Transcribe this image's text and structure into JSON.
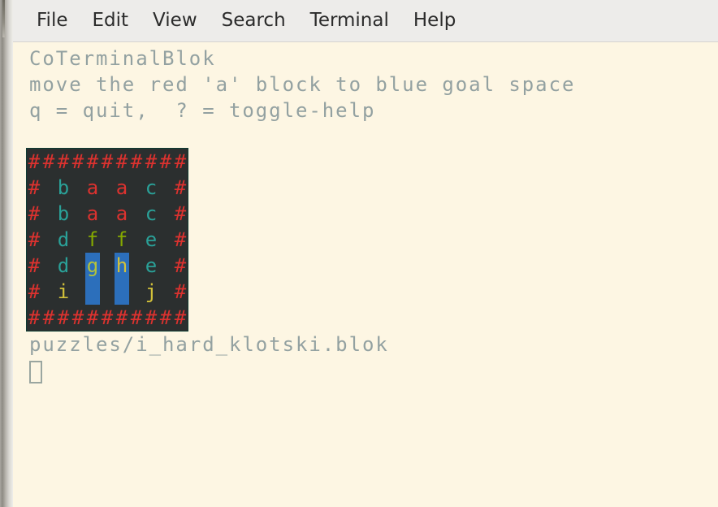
{
  "window": {
    "title": "CoTerminalBlok"
  },
  "menubar": {
    "items": [
      {
        "name": "file",
        "label": "File"
      },
      {
        "name": "edit",
        "label": "Edit"
      },
      {
        "name": "view",
        "label": "View"
      },
      {
        "name": "search",
        "label": "Search"
      },
      {
        "name": "terminal",
        "label": "Terminal"
      },
      {
        "name": "help",
        "label": "Help"
      }
    ]
  },
  "terminal": {
    "title_line": "CoTerminalBlok",
    "objective_line": "move the red 'a' block to blue goal space",
    "keys_line": "q = quit,  ? = toggle-help",
    "file_line": "puzzles/i_hard_klotski.blok",
    "cursor": ""
  },
  "colors": {
    "terminal_background": "#fdf6e3",
    "terminal_foreground": "#93a1a1",
    "menubar_background": "#edecea",
    "menubar_foreground": "#2b2b2b",
    "board_background": "#2b2f2f",
    "wall_red": "#dc322f",
    "block_cyan": "#2aa198",
    "block_red": "#dc322f",
    "block_green": "#85a900",
    "block_yellow": "#d3c23a",
    "goal_blue": "#2c6fbb"
  },
  "board": {
    "columns": 11,
    "rows": 7,
    "grid": [
      [
        {
          "ch": "#",
          "color": "#dc322f",
          "goal": false
        },
        {
          "ch": "#",
          "color": "#dc322f",
          "goal": false
        },
        {
          "ch": "#",
          "color": "#dc322f",
          "goal": false
        },
        {
          "ch": "#",
          "color": "#dc322f",
          "goal": false
        },
        {
          "ch": "#",
          "color": "#dc322f",
          "goal": false
        },
        {
          "ch": "#",
          "color": "#dc322f",
          "goal": false
        },
        {
          "ch": "#",
          "color": "#dc322f",
          "goal": false
        },
        {
          "ch": "#",
          "color": "#dc322f",
          "goal": false
        },
        {
          "ch": "#",
          "color": "#dc322f",
          "goal": false
        },
        {
          "ch": "#",
          "color": "#dc322f",
          "goal": false
        },
        {
          "ch": "#",
          "color": "#dc322f",
          "goal": false
        }
      ],
      [
        {
          "ch": "#",
          "color": "#dc322f",
          "goal": false
        },
        {
          "ch": " ",
          "color": "#2b2f2f",
          "goal": false
        },
        {
          "ch": "b",
          "color": "#2aa198",
          "goal": false
        },
        {
          "ch": " ",
          "color": "#2b2f2f",
          "goal": false
        },
        {
          "ch": "a",
          "color": "#dc322f",
          "goal": false
        },
        {
          "ch": " ",
          "color": "#2b2f2f",
          "goal": false
        },
        {
          "ch": "a",
          "color": "#dc322f",
          "goal": false
        },
        {
          "ch": " ",
          "color": "#2b2f2f",
          "goal": false
        },
        {
          "ch": "c",
          "color": "#2aa198",
          "goal": false
        },
        {
          "ch": " ",
          "color": "#2b2f2f",
          "goal": false
        },
        {
          "ch": "#",
          "color": "#dc322f",
          "goal": false
        }
      ],
      [
        {
          "ch": "#",
          "color": "#dc322f",
          "goal": false
        },
        {
          "ch": " ",
          "color": "#2b2f2f",
          "goal": false
        },
        {
          "ch": "b",
          "color": "#2aa198",
          "goal": false
        },
        {
          "ch": " ",
          "color": "#2b2f2f",
          "goal": false
        },
        {
          "ch": "a",
          "color": "#dc322f",
          "goal": false
        },
        {
          "ch": " ",
          "color": "#2b2f2f",
          "goal": false
        },
        {
          "ch": "a",
          "color": "#dc322f",
          "goal": false
        },
        {
          "ch": " ",
          "color": "#2b2f2f",
          "goal": false
        },
        {
          "ch": "c",
          "color": "#2aa198",
          "goal": false
        },
        {
          "ch": " ",
          "color": "#2b2f2f",
          "goal": false
        },
        {
          "ch": "#",
          "color": "#dc322f",
          "goal": false
        }
      ],
      [
        {
          "ch": "#",
          "color": "#dc322f",
          "goal": false
        },
        {
          "ch": " ",
          "color": "#2b2f2f",
          "goal": false
        },
        {
          "ch": "d",
          "color": "#2aa198",
          "goal": false
        },
        {
          "ch": " ",
          "color": "#2b2f2f",
          "goal": false
        },
        {
          "ch": "f",
          "color": "#85a900",
          "goal": false
        },
        {
          "ch": " ",
          "color": "#2b2f2f",
          "goal": false
        },
        {
          "ch": "f",
          "color": "#85a900",
          "goal": false
        },
        {
          "ch": " ",
          "color": "#2b2f2f",
          "goal": false
        },
        {
          "ch": "e",
          "color": "#2aa198",
          "goal": false
        },
        {
          "ch": " ",
          "color": "#2b2f2f",
          "goal": false
        },
        {
          "ch": "#",
          "color": "#dc322f",
          "goal": false
        }
      ],
      [
        {
          "ch": "#",
          "color": "#dc322f",
          "goal": false
        },
        {
          "ch": " ",
          "color": "#2b2f2f",
          "goal": false
        },
        {
          "ch": "d",
          "color": "#2aa198",
          "goal": false
        },
        {
          "ch": " ",
          "color": "#2b2f2f",
          "goal": false
        },
        {
          "ch": "g",
          "color": "#b4c23a",
          "goal": true
        },
        {
          "ch": " ",
          "color": "#2b2f2f",
          "goal": false
        },
        {
          "ch": "h",
          "color": "#d3c23a",
          "goal": true
        },
        {
          "ch": " ",
          "color": "#2b2f2f",
          "goal": false
        },
        {
          "ch": "e",
          "color": "#2aa198",
          "goal": false
        },
        {
          "ch": " ",
          "color": "#2b2f2f",
          "goal": false
        },
        {
          "ch": "#",
          "color": "#dc322f",
          "goal": false
        }
      ],
      [
        {
          "ch": "#",
          "color": "#dc322f",
          "goal": false
        },
        {
          "ch": " ",
          "color": "#2b2f2f",
          "goal": false
        },
        {
          "ch": "i",
          "color": "#d3c23a",
          "goal": false
        },
        {
          "ch": " ",
          "color": "#2b2f2f",
          "goal": false
        },
        {
          "ch": " ",
          "color": "#2c6fbb",
          "goal": true
        },
        {
          "ch": " ",
          "color": "#2b2f2f",
          "goal": false
        },
        {
          "ch": " ",
          "color": "#2c6fbb",
          "goal": true
        },
        {
          "ch": " ",
          "color": "#2b2f2f",
          "goal": false
        },
        {
          "ch": "j",
          "color": "#d3c23a",
          "goal": false
        },
        {
          "ch": " ",
          "color": "#2b2f2f",
          "goal": false
        },
        {
          "ch": "#",
          "color": "#dc322f",
          "goal": false
        }
      ],
      [
        {
          "ch": "#",
          "color": "#dc322f",
          "goal": false
        },
        {
          "ch": "#",
          "color": "#dc322f",
          "goal": false
        },
        {
          "ch": "#",
          "color": "#dc322f",
          "goal": false
        },
        {
          "ch": "#",
          "color": "#dc322f",
          "goal": false
        },
        {
          "ch": "#",
          "color": "#dc322f",
          "goal": false
        },
        {
          "ch": "#",
          "color": "#dc322f",
          "goal": false
        },
        {
          "ch": "#",
          "color": "#dc322f",
          "goal": false
        },
        {
          "ch": "#",
          "color": "#dc322f",
          "goal": false
        },
        {
          "ch": "#",
          "color": "#dc322f",
          "goal": false
        },
        {
          "ch": "#",
          "color": "#dc322f",
          "goal": false
        },
        {
          "ch": "#",
          "color": "#dc322f",
          "goal": false
        }
      ]
    ]
  }
}
